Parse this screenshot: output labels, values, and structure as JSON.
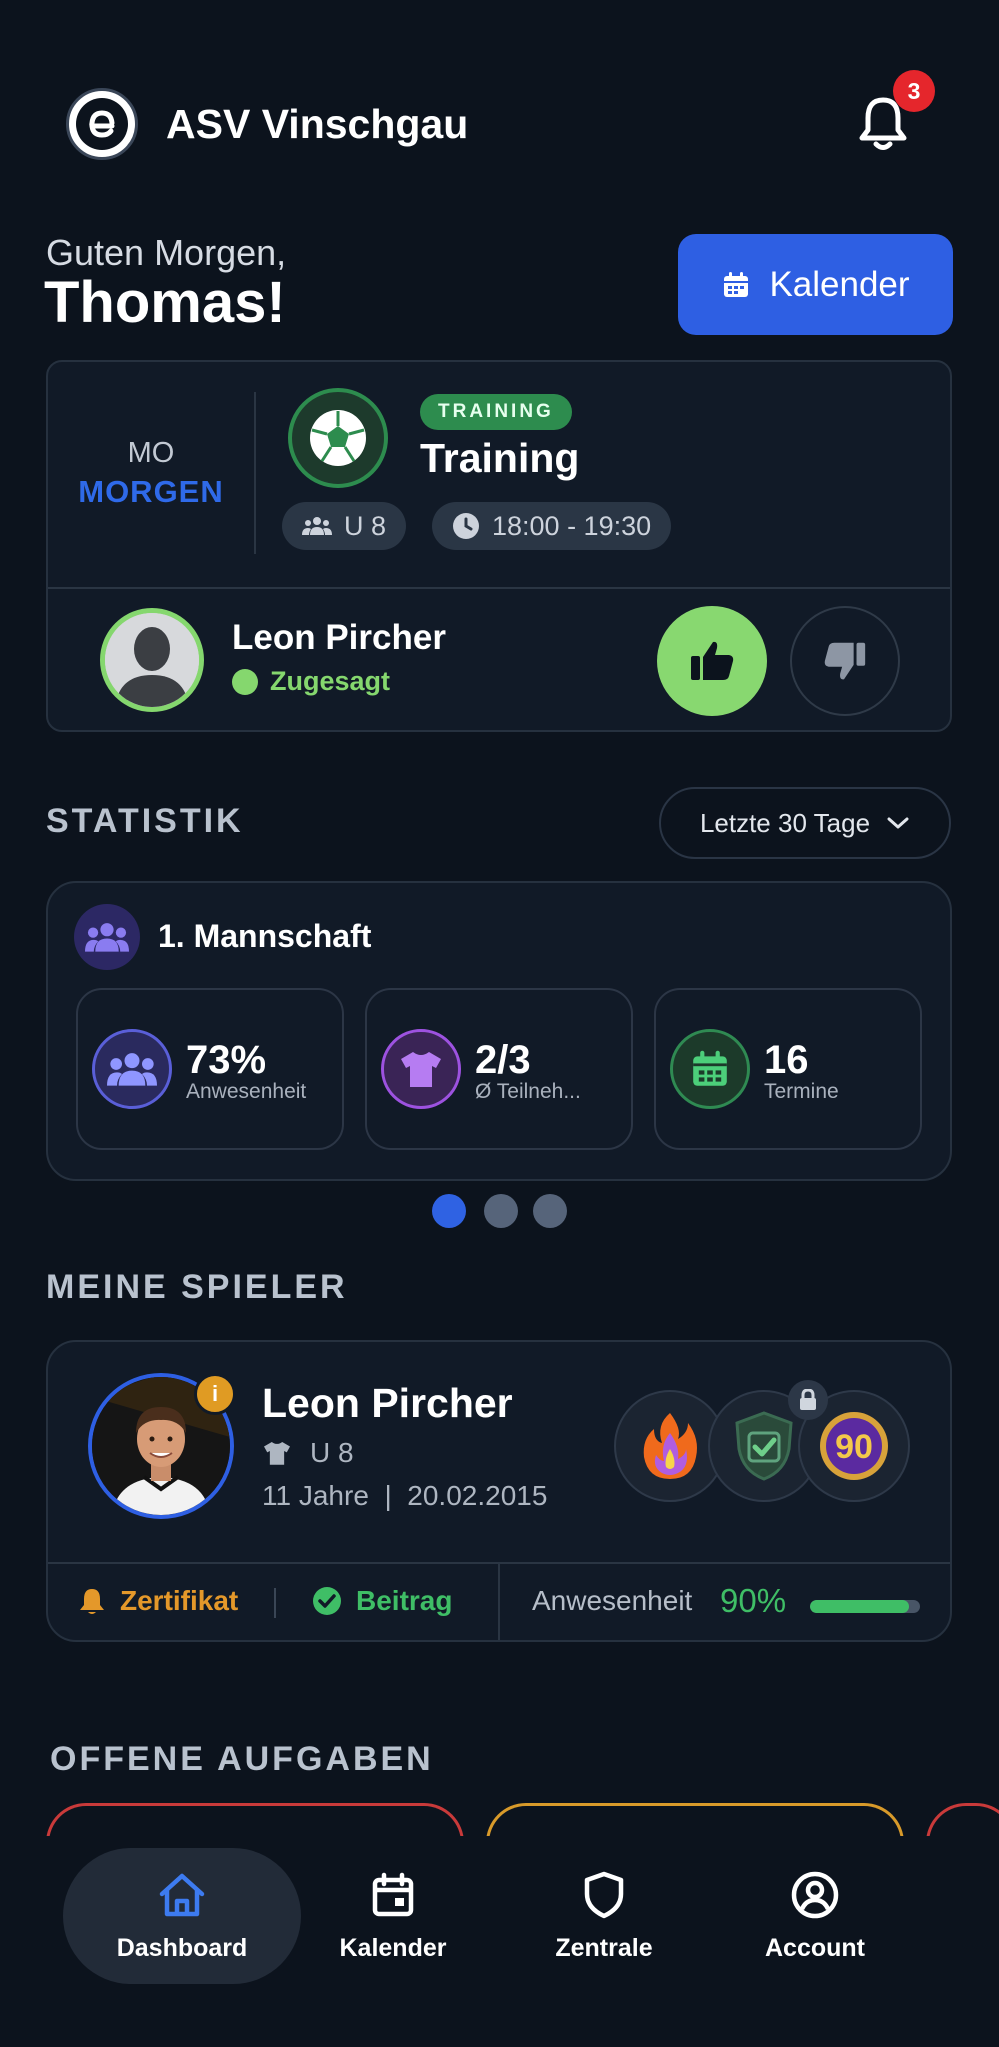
{
  "header": {
    "club_name": "ASV Vinschgau",
    "notification_count": "3"
  },
  "greeting": {
    "line1": "Guten Morgen,",
    "name": "Thomas!",
    "calendar_button": "Kalender"
  },
  "next_event": {
    "day": "MO",
    "when": "MORGEN",
    "badge": "TRAINING",
    "title": "Training",
    "team": "U 8",
    "time": "18:00 - 19:30",
    "player_name": "Leon Pircher",
    "player_status": "Zugesagt"
  },
  "statistik": {
    "title": "STATISTIK",
    "range": "Letzte 30 Tage",
    "team": "1. Mannschaft",
    "cards": [
      {
        "value": "73%",
        "label": "Anwesenheit"
      },
      {
        "value": "2/3",
        "label": "Ø Teilneh..."
      },
      {
        "value": "16",
        "label": "Termine"
      }
    ],
    "pager_active": 1,
    "pager_total": 3
  },
  "meine_spieler": {
    "title": "MEINE SPIELER",
    "player": {
      "name": "Leon Pircher",
      "team": "U 8",
      "meta": "11 Jahre  |  20.02.2015",
      "achievement_value": "90",
      "certificate": "Zertifikat",
      "fee": "Beitrag",
      "attendance_label": "Anwesenheit",
      "attendance_value": "90%",
      "attendance_fraction": 0.9
    }
  },
  "offene_aufgaben": {
    "title": "OFFENE AUFGABEN"
  },
  "nav": {
    "items": [
      {
        "label": "Dashboard"
      },
      {
        "label": "Kalender"
      },
      {
        "label": "Zentrale"
      },
      {
        "label": "Account"
      }
    ]
  },
  "colors": {
    "background": "#0c131d",
    "accent_blue": "#2e5fe3",
    "success_green": "#85d76e",
    "attendance_green": "#3fbe66",
    "warning_orange": "#e4982a",
    "badge_red": "#e5262c"
  }
}
